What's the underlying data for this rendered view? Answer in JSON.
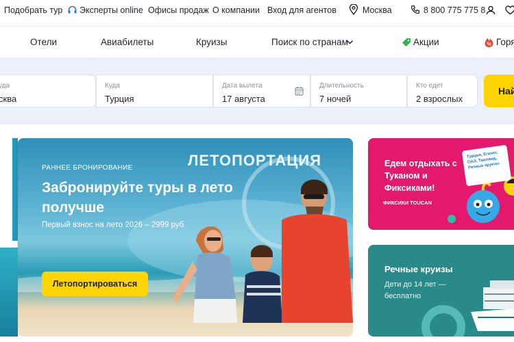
{
  "topbar": {
    "find_tour": "Подобрать тур",
    "experts_online": "Эксперты online",
    "sales_offices": "Офисы продаж",
    "about": "О компании",
    "agent_login": "Вход для агентов",
    "city": "Москва",
    "phone": "8 800 775 775 8"
  },
  "nav": {
    "hotels": "Отели",
    "flights": "Авиабилеты",
    "cruises": "Круизы",
    "country_search": "Поиск по странам",
    "promos": "Акции",
    "hot": "Горя"
  },
  "search": {
    "from_label": "уда",
    "from_value": "сква",
    "to_label": "Куда",
    "to_value": "Турция",
    "date_label": "Дата вылета",
    "date_value": "17 августа",
    "duration_label": "Длительность",
    "duration_value": "7 ночей",
    "who_label": "Кто едет",
    "who_value": "2 взрослых",
    "button": "Най"
  },
  "hero": {
    "kicker": "РАННЕЕ БРОНИРОВАНИЕ",
    "brand": "ЛЕТОПОРТАЦИЯ",
    "title": "Забронируйте туры в лето получше",
    "subtitle": "Первый взнос на лето 2026 – 2999 руб",
    "cta": "Летопортироваться"
  },
  "promo_pink": {
    "text": "Едем отдыхать с Туканом и Фиксиками!",
    "card_text": "Турция, Египет, ОАЭ, Таиланд, Речные круизы",
    "logos": "ФИКСИКИ   TOUCAN"
  },
  "promo_teal": {
    "title": "Речные круизы",
    "subtitle": "Дети до 14 лет — бесплатно"
  },
  "colors": {
    "accent_yellow": "#ffd400",
    "band_bg": "#edf0fa",
    "pink": "#e4196e",
    "teal": "#2a8a8a",
    "expert_icon": "#3a6fe0",
    "promo_tag": "#2fb34a",
    "hot_icon": "#e8452f"
  },
  "icons": [
    "headset-icon",
    "location-pin-icon",
    "phone-icon",
    "user-icon",
    "heart-icon",
    "chevron-down-icon",
    "tag-icon",
    "fire-icon",
    "calendar-icon"
  ]
}
